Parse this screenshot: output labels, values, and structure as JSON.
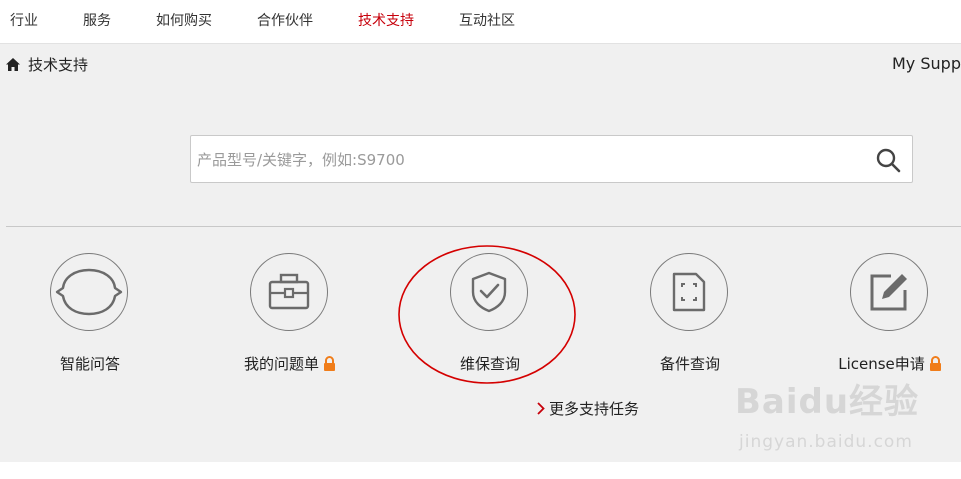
{
  "topnav": {
    "items": [
      {
        "label": "行业"
      },
      {
        "label": "服务"
      },
      {
        "label": "如何购买"
      },
      {
        "label": "合作伙伴"
      },
      {
        "label": "技术支持",
        "active": true
      },
      {
        "label": "互动社区"
      }
    ]
  },
  "breadcrumb": {
    "label": "技术支持",
    "icon": "home-icon"
  },
  "my_support": {
    "label": "My Supp"
  },
  "search": {
    "placeholder": "产品型号/关键字，例如:S9700",
    "value": "",
    "icon": "search-icon"
  },
  "tiles": [
    {
      "label": "智能问答",
      "icon": "chat-bubble-icon",
      "locked": false
    },
    {
      "label": "我的问题单",
      "icon": "toolbox-icon",
      "locked": true
    },
    {
      "label": "维保查询",
      "icon": "shield-check-icon",
      "locked": false
    },
    {
      "label": "备件查询",
      "icon": "sim-card-icon",
      "locked": false
    },
    {
      "label": "License申请",
      "icon": "edit-icon",
      "locked": true
    }
  ],
  "more_tasks": {
    "label": "更多支持任务"
  },
  "watermark": {
    "brand": "Baidu经验",
    "url": "jingyan.baidu.com"
  },
  "colors": {
    "accent": "#c7000b",
    "lock": "#f07d1a",
    "annotation": "#d40000",
    "panel_bg": "#f0f0f0"
  }
}
